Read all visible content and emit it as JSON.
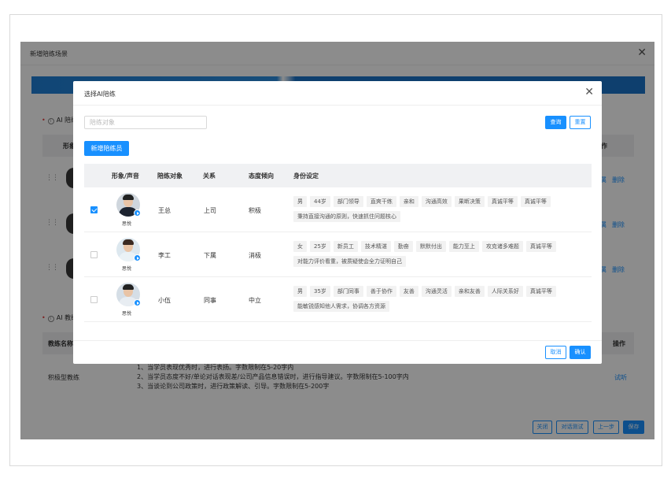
{
  "outer_dialog": {
    "title": "新增陪练场景",
    "section_ai_partner": "AI 陪练",
    "col_image": "形象",
    "col_action": "作",
    "delete_label": "删除",
    "prefix_label": "属",
    "section_ai_coach": "AI 教练",
    "col_coach_name": "教练名称",
    "col_operation": "操作",
    "coach_name": "积极型教练",
    "rules": [
      "1、当学员表现优秀时，进行表扬。字数限制在5-20字内",
      "2、当学员态度不好/单论对话表现差/公司产品信息错误时，进行指导建议。字数限制在5-100字内",
      "3、当谈论到公司政策时，进行政策解读、引导。字数限制在5-200字"
    ],
    "try_label": "试听",
    "footer": {
      "close": "关闭",
      "test": "对话测试",
      "prev": "上一步",
      "save": "保存"
    }
  },
  "modal": {
    "title": "选择AI陪练",
    "search_placeholder": "陪练对象",
    "query_button": "查询",
    "reset_button": "重置",
    "add_button": "新增陪练员",
    "columns": {
      "avatar": "形象/声音",
      "target": "陪练对象",
      "relation": "关系",
      "attitude": "态度倾向",
      "identity": "身份设定"
    },
    "rows": [
      {
        "checked": true,
        "voice": "思悦",
        "name": "王总",
        "relation": "上司",
        "attitude": "积极",
        "tags": [
          "男",
          "44岁",
          "部门领导",
          "直爽干练",
          "亲和",
          "沟通高效",
          "果断决策",
          "真诚平等",
          "真诚平等",
          "秉持直接沟通的原则，快速抓住问题核心"
        ]
      },
      {
        "checked": false,
        "voice": "思悦",
        "name": "李工",
        "relation": "下属",
        "attitude": "消极",
        "tags": [
          "女",
          "25岁",
          "新员工",
          "技术精湛",
          "勤奋",
          "默默付出",
          "能力至上",
          "攻克诸多难题",
          "真诚平等",
          "对能力评价看重，被质疑使会全力证明自己"
        ]
      },
      {
        "checked": false,
        "voice": "思悦",
        "name": "小伍",
        "relation": "同事",
        "attitude": "中立",
        "tags": [
          "男",
          "35岁",
          "部门同事",
          "善于协作",
          "友善",
          "沟通灵活",
          "亲和友善",
          "人际关系好",
          "真诚平等",
          "能敏锐感知他人需求，协调各方资源"
        ]
      }
    ],
    "cancel_button": "取消",
    "confirm_button": "确认"
  },
  "colors": {
    "primary": "#1890ff",
    "tag_bg": "#f2f2f2",
    "header_bg": "#f0f1f3",
    "overlay": "rgba(0,0,0,0.45)"
  }
}
